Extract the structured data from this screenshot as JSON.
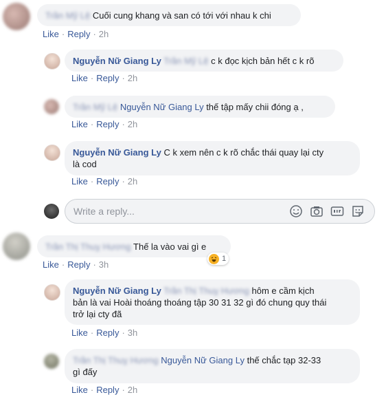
{
  "actions": {
    "like": "Like",
    "reply": "Reply"
  },
  "comments": [
    {
      "author": "Trần Mỹ Lệ",
      "text": "Cuối cung khang và san có tới với nhau k chi",
      "time": "2h"
    },
    {
      "author": "Nguyễn Nữ Giang Ly",
      "mention": "Trần Mỹ Lệ",
      "text": "c k đọc kịch bản hết c k rõ",
      "time": "2h"
    },
    {
      "author": "Trần Mỹ Lệ",
      "mention": "Nguyễn Nữ Giang Ly",
      "text": "thế tập mấy chii đóng ạ ,",
      "time": "2h"
    },
    {
      "author": "Nguyễn Nữ Giang Ly",
      "text_line1": "C k xem nên c k rõ chắc thái quay lại cty",
      "text_line2": "là cod",
      "time": "2h"
    },
    {
      "author": "Trần Thị Thuỵ Hương",
      "text": "Thế la vào vai gì e",
      "time": "3h",
      "reaction": {
        "icon": "laughing-emoji",
        "count": "1"
      }
    },
    {
      "author": "Nguyễn Nữ Giang Ly",
      "mention": "Trần Thị Thuỵ Hương",
      "text_line1": "hôm e cầm kịch",
      "text_line2": "bản là vai Hoài thoáng thoáng tập 30 31 32 gì đó chung quy thái",
      "text_line3": "trở lại cty đã",
      "time": "3h"
    },
    {
      "author": "Trần Thị Thuỵ Hương",
      "mention": "Nguyễn Nữ Giang Ly",
      "text_line1": "thế chắc tạp 32-33",
      "text_line2": "gì đấy",
      "time": "2h"
    }
  ],
  "reply_box": {
    "placeholder": "Write a reply...",
    "icons": [
      "emoji-icon",
      "camera-icon",
      "gif-icon",
      "sticker-icon"
    ]
  },
  "colors": {
    "link": "#385898",
    "bubble": "#f2f3f5",
    "meta": "#90949c"
  }
}
